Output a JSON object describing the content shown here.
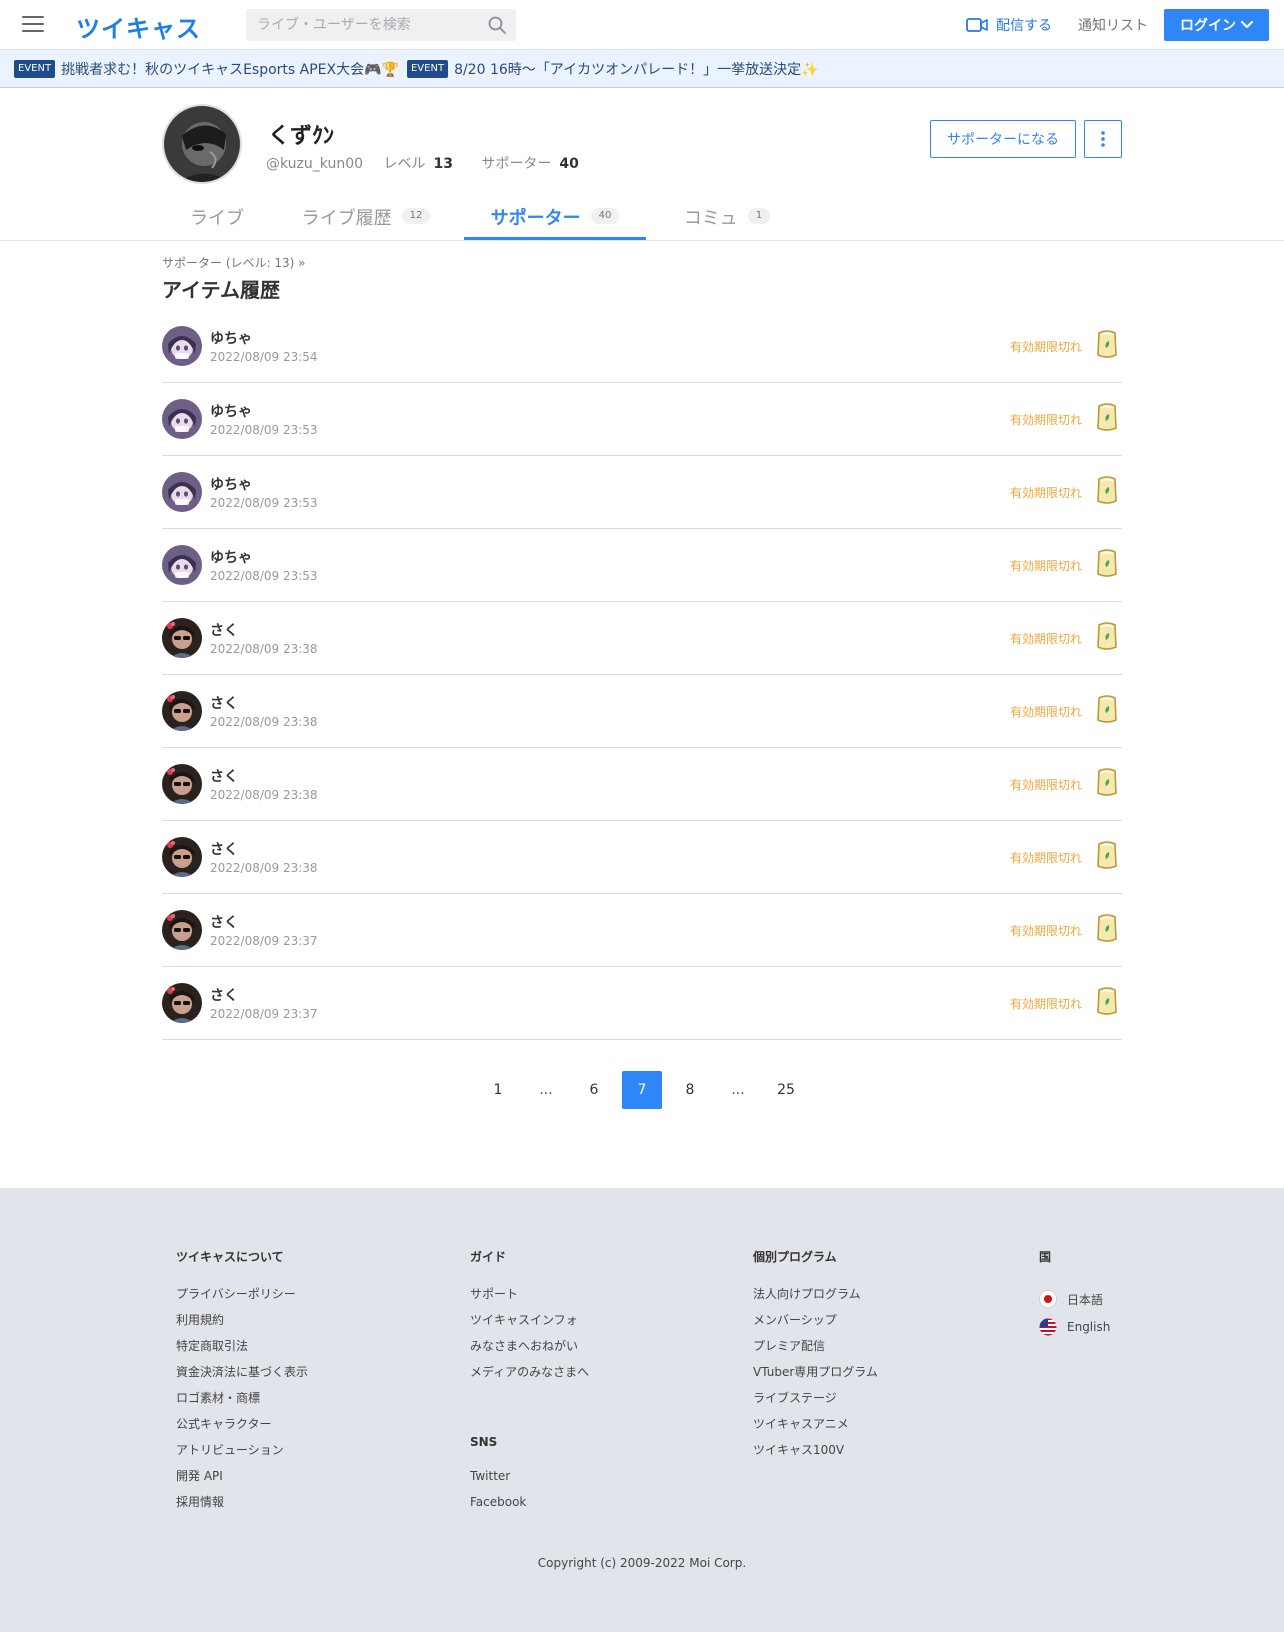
{
  "header": {
    "logo": "ツイキャス",
    "search_placeholder": "ライブ・ユーザーを検索",
    "broadcast_label": "配信する",
    "notify_label": "通知リスト",
    "login_label": "ログイン"
  },
  "banner": {
    "items": [
      {
        "badge": "EVENT",
        "text": "挑戦者求む！秋のツイキャスEsports APEX大会🎮🏆"
      },
      {
        "badge": "EVENT",
        "text": "8/20 16時〜「アイカツオンパレード！」一挙放送決定✨"
      }
    ]
  },
  "profile": {
    "name": "くずｸﾝ",
    "handle": "@kuzu_kun00",
    "level_label": "レベル",
    "level_value": "13",
    "supporter_label": "サポーター",
    "supporter_value": "40",
    "become_supporter": "サポーターになる"
  },
  "tabs": [
    {
      "label": "ライブ",
      "count": ""
    },
    {
      "label": "ライブ履歴",
      "count": "12"
    },
    {
      "label": "サポーター",
      "count": "40",
      "active": true
    },
    {
      "label": "コミュ",
      "count": "1"
    }
  ],
  "content": {
    "breadcrumb": "サポーター (レベル: 13)  »",
    "title": "アイテム履歴"
  },
  "rows": [
    {
      "name": "ゆちゃ",
      "time": "2022/08/09 23:54",
      "status": "有効期限切れ",
      "avatar": "yucha"
    },
    {
      "name": "ゆちゃ",
      "time": "2022/08/09 23:53",
      "status": "有効期限切れ",
      "avatar": "yucha"
    },
    {
      "name": "ゆちゃ",
      "time": "2022/08/09 23:53",
      "status": "有効期限切れ",
      "avatar": "yucha"
    },
    {
      "name": "ゆちゃ",
      "time": "2022/08/09 23:53",
      "status": "有効期限切れ",
      "avatar": "yucha"
    },
    {
      "name": "さく",
      "time": "2022/08/09 23:38",
      "status": "有効期限切れ",
      "avatar": "saku"
    },
    {
      "name": "さく",
      "time": "2022/08/09 23:38",
      "status": "有効期限切れ",
      "avatar": "saku"
    },
    {
      "name": "さく",
      "time": "2022/08/09 23:38",
      "status": "有効期限切れ",
      "avatar": "saku"
    },
    {
      "name": "さく",
      "time": "2022/08/09 23:38",
      "status": "有効期限切れ",
      "avatar": "saku"
    },
    {
      "name": "さく",
      "time": "2022/08/09 23:37",
      "status": "有効期限切れ",
      "avatar": "saku"
    },
    {
      "name": "さく",
      "time": "2022/08/09 23:37",
      "status": "有効期限切れ",
      "avatar": "saku"
    }
  ],
  "pagination": [
    "1",
    "...",
    "6",
    "7",
    "8",
    "...",
    "25"
  ],
  "pagination_active": "7",
  "footer": {
    "col1": {
      "title": "ツイキャスについて",
      "links": [
        "プライバシーポリシー",
        "利用規約",
        "特定商取引法",
        "資金決済法に基づく表示",
        "ロゴ素材・商標",
        "公式キャラクター",
        "アトリビューション",
        "開発 API",
        "採用情報"
      ]
    },
    "col2": {
      "title": "ガイド",
      "links": [
        "サポート",
        "ツイキャスインフォ",
        "みなさまへおねがい",
        "メディアのみなさまへ"
      ]
    },
    "sns": {
      "title": "SNS",
      "links": [
        "Twitter",
        "Facebook"
      ]
    },
    "col3": {
      "title": "個別プログラム",
      "links": [
        "法人向けプログラム",
        "メンバーシップ",
        "プレミア配信",
        "VTuber専用プログラム",
        "ライブステージ",
        "ツイキャスアニメ",
        "ツイキャス100V"
      ]
    },
    "col4": {
      "title": "国",
      "langs": [
        "日本語",
        "English"
      ]
    },
    "copyright": "Copyright (c) 2009-2022 Moi Corp."
  },
  "colors": {
    "accent": "#2f86f6",
    "expired": "#f0a63a",
    "footer_bg": "#e1e4ea"
  }
}
